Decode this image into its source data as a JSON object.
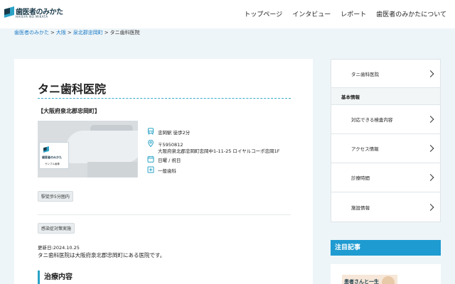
{
  "header": {
    "logo_text": "歯医者のみかた",
    "logo_sub": "HAISYA NO MIKATA",
    "nav": [
      "トップページ",
      "インタビュー",
      "レポート",
      "歯医者のみかたについて"
    ]
  },
  "breadcrumb": {
    "items": [
      "歯医者のみかた",
      "大阪",
      "泉北郡忠岡町"
    ],
    "sep": ">",
    "current": "タニ歯科医院"
  },
  "clinic": {
    "name": "タニ歯科医院",
    "region": "【大阪府泉北郡忠岡町】",
    "photo_badge": {
      "title": "歯医者のみかた",
      "caption": "サンプル画像"
    },
    "access": "忠岡駅 徒歩2分",
    "postal": "〒5950812",
    "address": "大阪府泉北郡忠岡町忠岡中1-11-25 ロイヤルコーポ忠岡1F",
    "holidays": "日曜 / 祝日",
    "specialty": "一般歯科",
    "tags": [
      "駅徒歩5分圏内",
      "感染症対策実施"
    ],
    "updated": "更新日:2024.10.25",
    "description": "タニ歯科医院は大阪府泉北郡忠岡町にある医院です。",
    "section_title": "治療内容"
  },
  "sidebar": {
    "top_item": "タニ歯科医院",
    "heading": "基本情報",
    "items": [
      "対応できる検査内容",
      "アクセス情報",
      "診療時間",
      "施設情報"
    ]
  },
  "featured": {
    "heading": "注目記事",
    "card_text": "患者さんと一生"
  },
  "colors": {
    "accent": "#1e9bd1",
    "link": "#1e7bc6",
    "background": "#eef5f8"
  }
}
